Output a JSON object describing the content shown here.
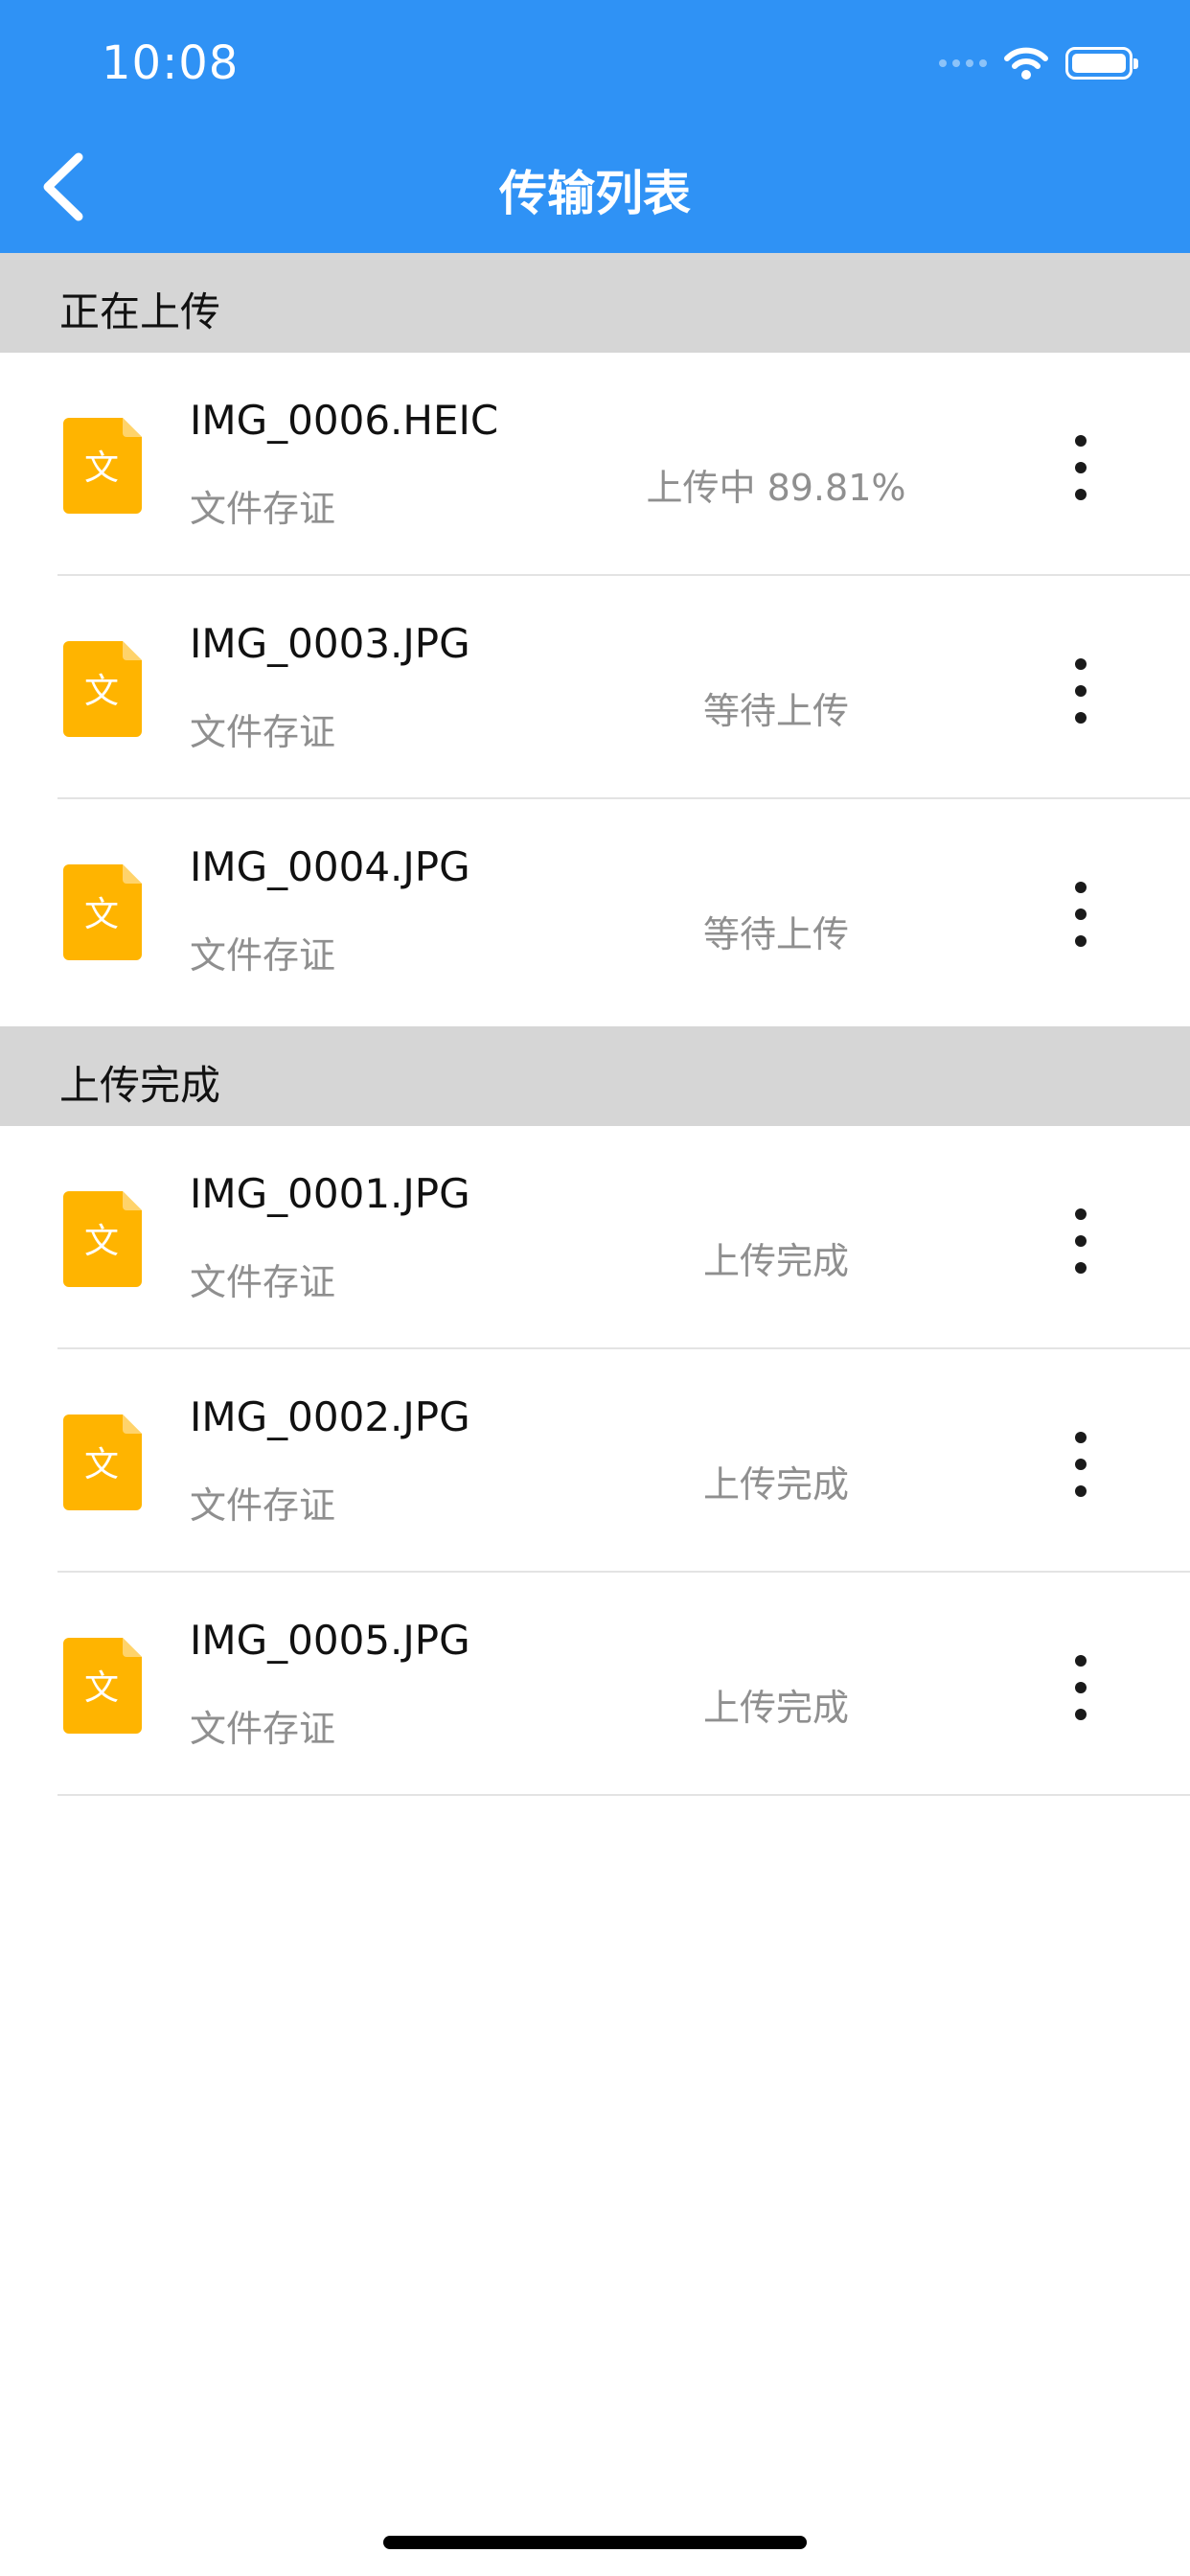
{
  "status_bar": {
    "time": "10:08"
  },
  "header": {
    "title": "传输列表"
  },
  "sections": [
    {
      "title": "正在上传",
      "items": [
        {
          "name": "IMG_0006.HEIC",
          "type": "文件存证",
          "status": "上传中 89.81%",
          "icon_glyph": "文"
        },
        {
          "name": "IMG_0003.JPG",
          "type": "文件存证",
          "status": "等待上传",
          "icon_glyph": "文"
        },
        {
          "name": "IMG_0004.JPG",
          "type": "文件存证",
          "status": "等待上传",
          "icon_glyph": "文"
        }
      ]
    },
    {
      "title": "上传完成",
      "items": [
        {
          "name": "IMG_0001.JPG",
          "type": "文件存证",
          "status": "上传完成",
          "icon_glyph": "文"
        },
        {
          "name": "IMG_0002.JPG",
          "type": "文件存证",
          "status": "上传完成",
          "icon_glyph": "文"
        },
        {
          "name": "IMG_0005.JPG",
          "type": "文件存证",
          "status": "上传完成",
          "icon_glyph": "文"
        }
      ]
    }
  ],
  "colors": {
    "header": "#2f92f5",
    "file_icon": "#ffb400",
    "section_bg": "#d6d6d6"
  }
}
